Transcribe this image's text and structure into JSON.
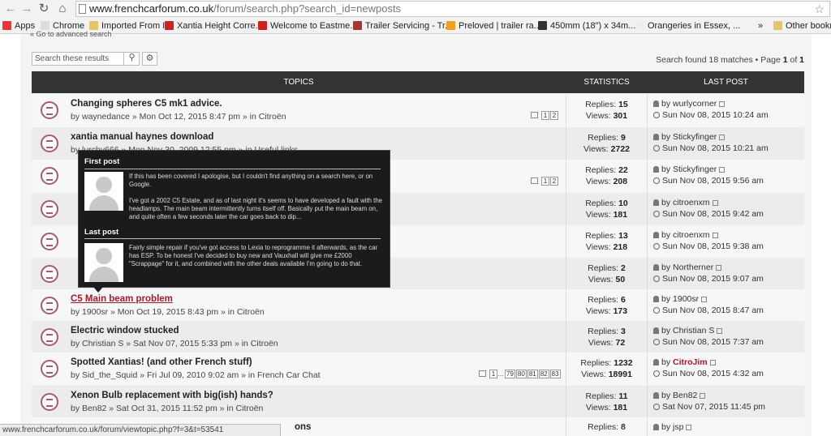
{
  "browser": {
    "url_host": "www.frenchcarforum.co.uk",
    "url_rest": "/forum/search.php?search_id=newposts",
    "bookmarks": [
      {
        "label": "Apps",
        "color": "#e33"
      },
      {
        "label": "Chrome",
        "color": "#ddd"
      },
      {
        "label": "Imported From IE",
        "color": "#e6c46a"
      },
      {
        "label": "Xantia Height Corre...",
        "color": "#c22"
      },
      {
        "label": "Welcome to Eastme...",
        "color": "#c22"
      },
      {
        "label": "Trailer Servicing - Tr...",
        "color": "#a33"
      },
      {
        "label": "Preloved | trailer ra...",
        "color": "#f0a020"
      },
      {
        "label": "450mm (18\") x 34m...",
        "color": "#333"
      },
      {
        "label": "Orangeries in Essex, ...",
        "color": "#eee"
      },
      {
        "label": "»",
        "color": ""
      },
      {
        "label": "Other bookm",
        "color": "#e6c46a"
      }
    ]
  },
  "forum": {
    "advanced_link": "« Go to advanced search",
    "search_placeholder": "Search these results",
    "found_text": "Search found 18 matches • Page ",
    "page_cur": "1",
    "of_text": " of ",
    "page_total": "1",
    "headers": {
      "topics": "TOPICS",
      "statistics": "STATISTICS",
      "last_post": "LAST POST"
    }
  },
  "topics": [
    {
      "title": "Changing spheres C5 mk1 advice.",
      "meta": "by waynedance » Mon Oct 12, 2015 8:47 pm » in Citroën",
      "replies": "15",
      "views": "301",
      "last_by": "wurlycorner",
      "last_time": "Sun Nov 08, 2015 10:24 am",
      "pages": [
        "1",
        "2"
      ]
    },
    {
      "title": "xantia manual haynes download",
      "meta": "by lurchy666 » Mon Nov 30, 2009 12:55 pm » in Useful links",
      "replies": "9",
      "views": "2722",
      "last_by": "Stickyfinger",
      "last_time": "Sun Nov 08, 2015 10:21 am",
      "pages": []
    },
    {
      "title": "",
      "meta": "",
      "replies": "22",
      "views": "208",
      "last_by": "Stickyfinger",
      "last_time": "Sun Nov 08, 2015 9:56 am",
      "pages": [
        "1",
        "2"
      ]
    },
    {
      "title": "",
      "meta": "",
      "replies": "10",
      "views": "181",
      "last_by": "citroenxm",
      "last_time": "Sun Nov 08, 2015 9:42 am",
      "pages": []
    },
    {
      "title": "",
      "meta": "",
      "replies": "13",
      "views": "218",
      "last_by": "citroenxm",
      "last_time": "Sun Nov 08, 2015 9:38 am",
      "pages": []
    },
    {
      "title": "",
      "meta": "",
      "replies": "2",
      "views": "50",
      "last_by": "Northerner",
      "last_time": "Sun Nov 08, 2015 9:07 am",
      "pages": []
    },
    {
      "title": "C5 Main beam problem",
      "meta": "by 1900sr » Mon Oct 19, 2015 8:43 pm » in Citroën",
      "replies": "6",
      "views": "173",
      "last_by": "1900sr",
      "last_time": "Sun Nov 08, 2015 8:47 am",
      "pages": []
    },
    {
      "title": "Electric window stucked",
      "meta": "by Christian S » Sat Nov 07, 2015 5:33 pm » in Citroën",
      "replies": "3",
      "views": "72",
      "last_by": "Christian S",
      "last_time": "Sun Nov 08, 2015 7:37 am",
      "pages": []
    },
    {
      "title": "Spotted Xantias! (and other French stuff)",
      "meta": "by Sid_the_Squid » Fri Jul 09, 2010 9:02 am » in French Car Chat",
      "replies": "1232",
      "views": "18991",
      "last_by": "CitroJim",
      "last_time": "Sun Nov 08, 2015 4:32 am",
      "pages": [
        "1",
        "…",
        "79",
        "80",
        "81",
        "82",
        "83"
      ]
    },
    {
      "title": "Xenon Bulb replacement with big(ish) hands?",
      "meta": "by Ben82 » Sat Oct 31, 2015 11:52 pm » in Citroën",
      "replies": "11",
      "views": "181",
      "last_by": "Ben82",
      "last_time": "Sat Nov 07, 2015 11:45 pm",
      "pages": []
    },
    {
      "title": "ons",
      "meta": "",
      "replies": "8",
      "views": "",
      "last_by": "jsp",
      "last_time": "",
      "pages": []
    }
  ],
  "tooltip": {
    "first_label": "First post",
    "first_text": "If this has been covered I apologise, but I couldn't find anything on a search here, or on Google.\n\nI've got a 2002 C5 Estate, and as of last night it's seems to have developed a fault with the headlamps. The main beam intermittently turns itself off. Basically put the main beam on, and quite often a few seconds later the car goes back to dip...",
    "last_label": "Last post",
    "last_text": "Fairly simple repair if you've got access to Lexia to reprogramme it afterwards, as the car has ESP. To be honest I've decided to buy new and Vauxhall will give me £2000 \"Scrappage\" for it, and combined with the other deals available I'm going to do that."
  },
  "status_url": "www.frenchcarforum.co.uk/forum/viewtopic.php?f=3&t=53541",
  "labels": {
    "replies": "Replies: ",
    "views": "Views: ",
    "by": "by "
  }
}
